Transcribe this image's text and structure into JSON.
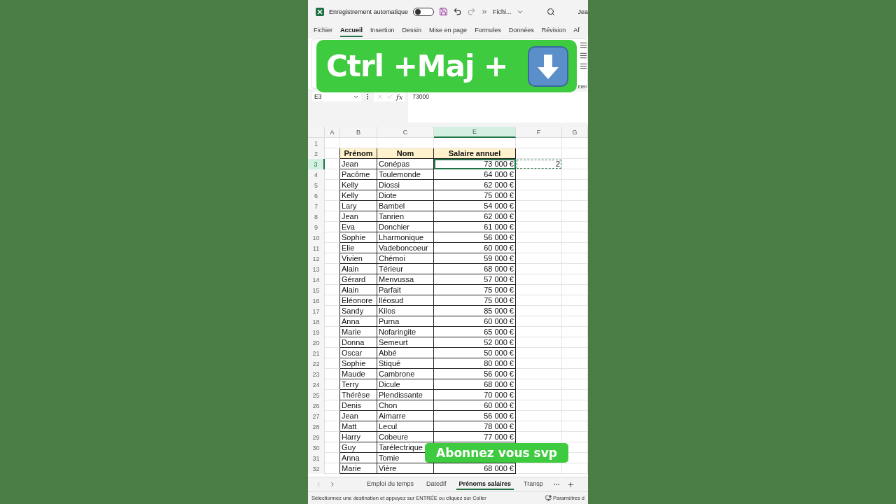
{
  "title_bar": {
    "autosave_label": "Enregistrement automatique",
    "autosave_on": false,
    "file_name": "Fichi...",
    "user": "Jea"
  },
  "menu_tabs": [
    {
      "label": "Fichier",
      "selected": false
    },
    {
      "label": "Accueil",
      "selected": true
    },
    {
      "label": "Insertion",
      "selected": false
    },
    {
      "label": "Dessin",
      "selected": false
    },
    {
      "label": "Mise en page",
      "selected": false
    },
    {
      "label": "Formules",
      "selected": false
    },
    {
      "label": "Données",
      "selected": false
    },
    {
      "label": "Révision",
      "selected": false
    },
    {
      "label": "Af",
      "selected": false
    }
  ],
  "ribbon": {
    "label": "men"
  },
  "formula_bar": {
    "name_box": "E3",
    "fx": "fx",
    "formula": "73000"
  },
  "columns": [
    {
      "label": "A",
      "selected": false
    },
    {
      "label": "B",
      "selected": false
    },
    {
      "label": "C",
      "selected": false
    },
    {
      "label": "E",
      "selected": true
    },
    {
      "label": "F",
      "selected": false
    },
    {
      "label": "G",
      "selected": false
    }
  ],
  "rows": [
    {
      "number": "1",
      "kind": "blank",
      "selected": false,
      "marquee": false
    },
    {
      "number": "2",
      "kind": "header",
      "selected": false,
      "marquee": false,
      "b": "Prénom",
      "c": "Nom",
      "e": "Salaire annuel"
    },
    {
      "number": "3",
      "kind": "data",
      "selected": true,
      "marquee": true,
      "b": "Jean",
      "c": "Conépas",
      "e": "73 000 €",
      "f": "2"
    },
    {
      "number": "4",
      "kind": "data",
      "selected": false,
      "marquee": false,
      "b": "Pacôme",
      "c": "Toulemonde",
      "e": "64 000 €"
    },
    {
      "number": "5",
      "kind": "data",
      "selected": false,
      "marquee": false,
      "b": "Kelly",
      "c": "Diossi",
      "e": "62 000 €"
    },
    {
      "number": "6",
      "kind": "data",
      "selected": false,
      "marquee": false,
      "b": "Kelly",
      "c": "Diote",
      "e": "75 000 €"
    },
    {
      "number": "7",
      "kind": "data",
      "selected": false,
      "marquee": false,
      "b": "Lary",
      "c": "Bambel",
      "e": "54 000 €"
    },
    {
      "number": "8",
      "kind": "data",
      "selected": false,
      "marquee": false,
      "b": "Jean",
      "c": "Tanrien",
      "e": "62 000 €"
    },
    {
      "number": "9",
      "kind": "data",
      "selected": false,
      "marquee": false,
      "b": "Eva",
      "c": "Donchier",
      "e": "61 000 €"
    },
    {
      "number": "10",
      "kind": "data",
      "selected": false,
      "marquee": false,
      "b": "Sophie",
      "c": "Lharmonique",
      "e": "56 000 €"
    },
    {
      "number": "11",
      "kind": "data",
      "selected": false,
      "marquee": false,
      "b": "Elie",
      "c": "Vadeboncoeur",
      "e": "60 000 €"
    },
    {
      "number": "12",
      "kind": "data",
      "selected": false,
      "marquee": false,
      "b": "Vivien",
      "c": "Chémoi",
      "e": "59 000 €"
    },
    {
      "number": "13",
      "kind": "data",
      "selected": false,
      "marquee": false,
      "b": "Alain",
      "c": "Térieur",
      "e": "68 000 €"
    },
    {
      "number": "14",
      "kind": "data",
      "selected": false,
      "marquee": false,
      "b": "Gérard",
      "c": "Menvussa",
      "e": "57 000 €"
    },
    {
      "number": "15",
      "kind": "data",
      "selected": false,
      "marquee": false,
      "b": "Alain",
      "c": "Parfait",
      "e": "75 000 €"
    },
    {
      "number": "16",
      "kind": "data",
      "selected": false,
      "marquee": false,
      "b": "Eléonore",
      "c": "Iléosud",
      "e": "75 000 €"
    },
    {
      "number": "17",
      "kind": "data",
      "selected": false,
      "marquee": false,
      "b": "Sandy",
      "c": "Kilos",
      "e": "85 000 €"
    },
    {
      "number": "18",
      "kind": "data",
      "selected": false,
      "marquee": false,
      "b": "Anna",
      "c": "Purna",
      "e": "60 000 €"
    },
    {
      "number": "19",
      "kind": "data",
      "selected": false,
      "marquee": false,
      "b": "Marie",
      "c": "Nofaringite",
      "e": "65 000 €"
    },
    {
      "number": "20",
      "kind": "data",
      "selected": false,
      "marquee": false,
      "b": "Donna",
      "c": "Semeurt",
      "e": "52 000 €"
    },
    {
      "number": "21",
      "kind": "data",
      "selected": false,
      "marquee": false,
      "b": "Oscar",
      "c": "Abbé",
      "e": "50 000 €"
    },
    {
      "number": "22",
      "kind": "data",
      "selected": false,
      "marquee": false,
      "b": "Sophie",
      "c": "Stiqué",
      "e": "80 000 €"
    },
    {
      "number": "23",
      "kind": "data",
      "selected": false,
      "marquee": false,
      "b": "Maude",
      "c": "Cambrone",
      "e": "56 000 €"
    },
    {
      "number": "24",
      "kind": "data",
      "selected": false,
      "marquee": false,
      "b": "Terry",
      "c": "Dicule",
      "e": "68 000 €"
    },
    {
      "number": "25",
      "kind": "data",
      "selected": false,
      "marquee": false,
      "b": "Thérèse",
      "c": "Plendissante",
      "e": "70 000 €"
    },
    {
      "number": "26",
      "kind": "data",
      "selected": false,
      "marquee": false,
      "b": "Denis",
      "c": "Chon",
      "e": "60 000 €"
    },
    {
      "number": "27",
      "kind": "data",
      "selected": false,
      "marquee": false,
      "b": "Jean",
      "c": "Aimarre",
      "e": "56 000 €"
    },
    {
      "number": "28",
      "kind": "data",
      "selected": false,
      "marquee": false,
      "b": "Matt",
      "c": "Lecul",
      "e": "78 000 €"
    },
    {
      "number": "29",
      "kind": "data",
      "selected": false,
      "marquee": false,
      "b": "Harry",
      "c": "Cobeure",
      "e": "77 000 €"
    },
    {
      "number": "30",
      "kind": "data",
      "selected": false,
      "marquee": false,
      "b": "Guy",
      "c": "Tarélectrique"
    },
    {
      "number": "31",
      "kind": "data",
      "selected": false,
      "marquee": false,
      "b": "Anna",
      "c": "Tomie"
    },
    {
      "number": "32",
      "kind": "data",
      "selected": false,
      "marquee": false,
      "b": "Marie",
      "c": "Vière",
      "e": "68 000 €"
    }
  ],
  "sheet_tabs": [
    {
      "label": "Emploi du temps",
      "selected": false
    },
    {
      "label": "Datedif",
      "selected": false
    },
    {
      "label": "Prénoms salaires",
      "selected": true
    },
    {
      "label": "Transp",
      "selected": false
    }
  ],
  "status_bar": {
    "message": "Sélectionnez une destination et appuyez sur ENTRÉE ou cliquez sur Coller",
    "settings": "Paramètres d"
  },
  "shortcut_banner": {
    "text": "Ctrl +Maj +"
  },
  "subscribe_banner": {
    "text": "Abonnez vous svp"
  }
}
